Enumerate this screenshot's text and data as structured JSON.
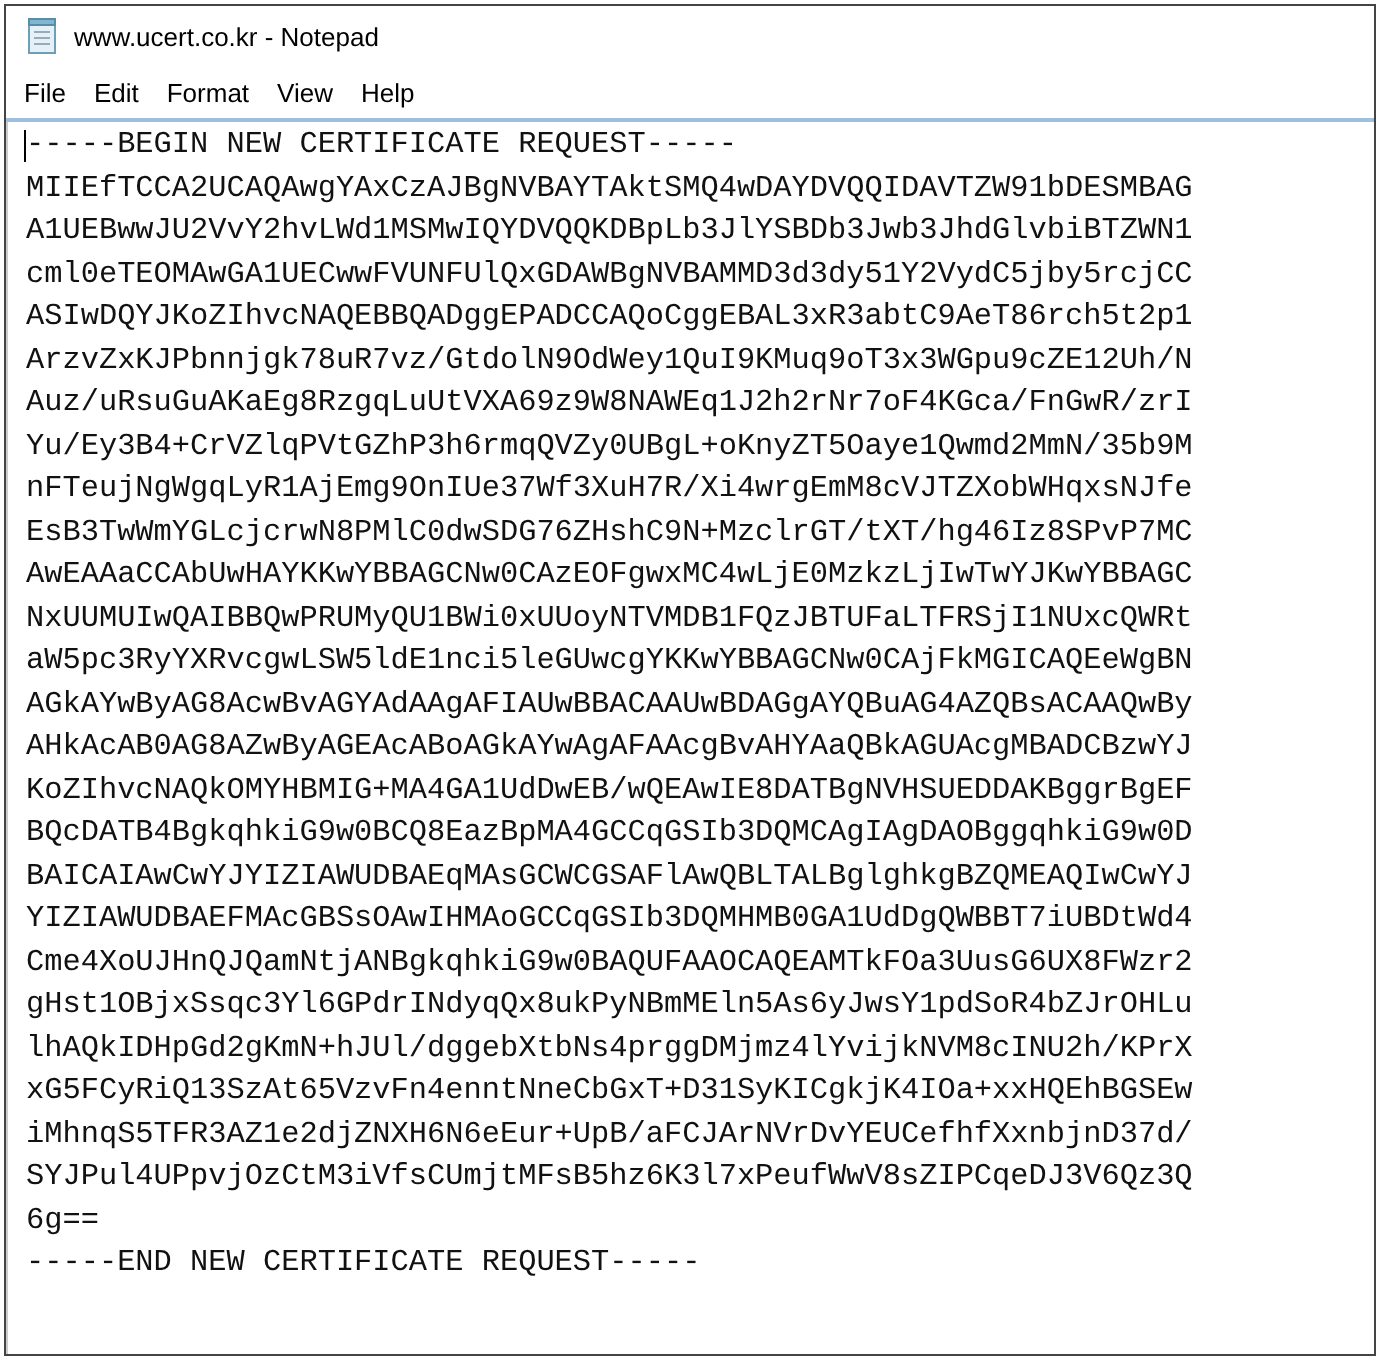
{
  "window": {
    "title": "www.ucert.co.kr - Notepad"
  },
  "menu": [
    "File",
    "Edit",
    "Format",
    "View",
    "Help"
  ],
  "document": {
    "caret_at_start": true,
    "lines": [
      "-----BEGIN NEW CERTIFICATE REQUEST-----",
      "MIIEfTCCA2UCAQAwgYAxCzAJBgNVBAYTAktSMQ4wDAYDVQQIDAVTZW91bDESMBAG",
      "A1UEBwwJU2VvY2hvLWd1MSMwIQYDVQQKDBpLb3JlYSBDb3Jwb3JhdGlvbiBTZWN1",
      "cml0eTEOMAwGA1UECwwFVUNFUlQxGDAWBgNVBAMMD3d3dy51Y2VydC5jby5rcjCC",
      "ASIwDQYJKoZIhvcNAQEBBQADggEPADCCAQoCggEBAL3xR3abtC9AeT86rch5t2p1",
      "ArzvZxKJPbnnjgk78uR7vz/GtdolN9OdWey1QuI9KMuq9oT3x3WGpu9cZE12Uh/N",
      "Auz/uRsuGuAKaEg8RzgqLuUtVXA69z9W8NAWEq1J2h2rNr7oF4KGca/FnGwR/zrI",
      "Yu/Ey3B4+CrVZlqPVtGZhP3h6rmqQVZy0UBgL+oKnyZT5Oaye1Qwmd2MmN/35b9M",
      "nFTeujNgWgqLyR1AjEmg9OnIUe37Wf3XuH7R/Xi4wrgEmM8cVJTZXobWHqxsNJfe",
      "EsB3TwWmYGLcjcrwN8PMlC0dwSDG76ZHshC9N+MzclrGT/tXT/hg46Iz8SPvP7MC",
      "AwEAAaCCAbUwHAYKKwYBBAGCNw0CAzEOFgwxMC4wLjE0MzkzLjIwTwYJKwYBBAGC",
      "NxUUMUIwQAIBBQwPRUMyQU1BWi0xUUoyNTVMDB1FQzJBTUFaLTFRSjI1NUxcQWRt",
      "aW5pc3RyYXRvcgwLSW5ldE1nci5leGUwcgYKKwYBBAGCNw0CAjFkMGICAQEeWgBN",
      "AGkAYwByAG8AcwBvAGYAdAAgAFIAUwBBACAAUwBDAGgAYQBuAG4AZQBsACAAQwBy",
      "AHkAcAB0AG8AZwByAGEAcABoAGkAYwAgAFAAcgBvAHYAaQBkAGUAcgMBADCBzwYJ",
      "KoZIhvcNAQkOMYHBMIG+MA4GA1UdDwEB/wQEAwIE8DATBgNVHSUEDDAKBggrBgEF",
      "BQcDATB4BgkqhkiG9w0BCQ8EazBpMA4GCCqGSIb3DQMCAgIAgDAOBggqhkiG9w0D",
      "BAICAIAwCwYJYIZIAWUDBAEqMAsGCWCGSAFlAwQBLTALBglghkgBZQMEAQIwCwYJ",
      "YIZIAWUDBAEFMAcGBSsOAwIHMAoGCCqGSIb3DQMHMB0GA1UdDgQWBBT7iUBDtWd4",
      "Cme4XoUJHnQJQamNtjANBgkqhkiG9w0BAQUFAAOCAQEAMTkFOa3UusG6UX8FWzr2",
      "gHst1OBjxSsqc3Yl6GPdrINdyqQx8ukPyNBmMEln5As6yJwsY1pdSoR4bZJrOHLu",
      "lhAQkIDHpGd2gKmN+hJUl/dggebXtbNs4prggDMjmz4lYvijkNVM8cINU2h/KPrX",
      "xG5FCyRiQ13SzAt65VzvFn4enntNneCbGxT+D31SyKICgkjK4IOa+xxHQEhBGSEw",
      "iMhnqS5TFR3AZ1e2djZNXH6N6eEur+UpB/aFCJArNVrDvYEUCefhfXxnbjnD37d/",
      "SYJPul4UPpvjOzCtM3iVfsCUmjtMFsB5hz6K3l7xPeufWwV8sZIPCqeDJ3V6Qz3Q",
      "6g==",
      "-----END NEW CERTIFICATE REQUEST-----"
    ]
  }
}
